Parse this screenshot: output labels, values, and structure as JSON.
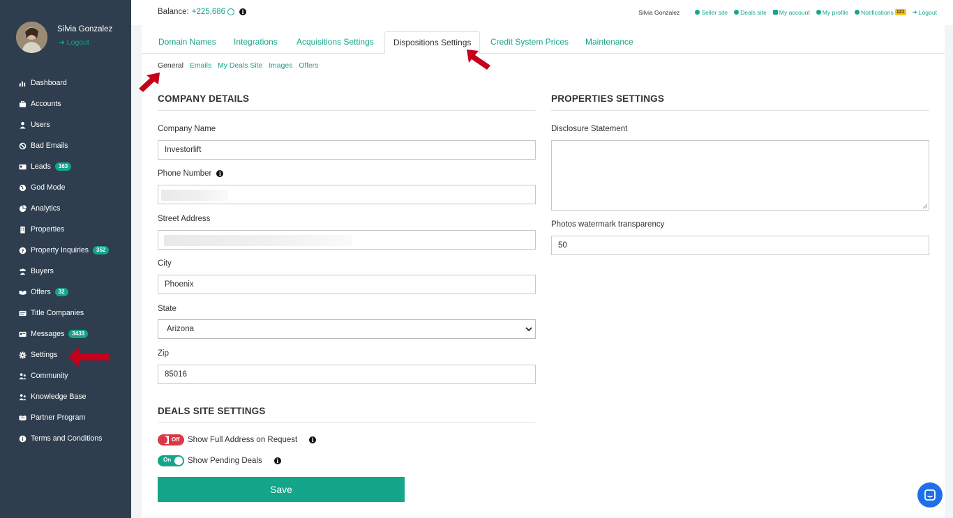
{
  "sidebar": {
    "user_name": "Silvia Gonzalez",
    "logout_label": "Logout",
    "items": [
      {
        "label": "Dashboard",
        "icon": "chart-icon"
      },
      {
        "label": "Accounts",
        "icon": "briefcase-icon"
      },
      {
        "label": "Users",
        "icon": "user-icon"
      },
      {
        "label": "Bad Emails",
        "icon": "ban-icon"
      },
      {
        "label": "Leads",
        "icon": "id-card-icon",
        "badge": "163"
      },
      {
        "label": "God Mode",
        "icon": "globe-icon"
      },
      {
        "label": "Analytics",
        "icon": "analytics-icon"
      },
      {
        "label": "Properties",
        "icon": "building-icon"
      },
      {
        "label": "Property Inquiries",
        "icon": "question-icon",
        "badge": "352"
      },
      {
        "label": "Buyers",
        "icon": "users-icon"
      },
      {
        "label": "Offers",
        "icon": "handshake-icon",
        "badge": "32"
      },
      {
        "label": "Title Companies",
        "icon": "list-icon"
      },
      {
        "label": "Messages",
        "icon": "message-icon",
        "badge": "3433"
      },
      {
        "label": "Settings",
        "icon": "gear-icon"
      },
      {
        "label": "Community",
        "icon": "community-icon"
      },
      {
        "label": "Knowledge Base",
        "icon": "knowledge-icon"
      },
      {
        "label": "Partner Program",
        "icon": "partner-icon"
      },
      {
        "label": "Terms and Conditions",
        "icon": "info-icon"
      }
    ]
  },
  "topbar": {
    "balance_label": "Balance:",
    "balance_value": "+225,686",
    "user_name": "Silvia Gonzalez",
    "links": {
      "seller_site": "Seller site",
      "deals_site": "Deals site",
      "my_account": "My account",
      "my_profile": "My profile",
      "notifications": "Notifications",
      "notifications_count": "121",
      "logout": "Logout"
    }
  },
  "tabs": [
    "Domain Names",
    "Integrations",
    "Acquisitions Settings",
    "Dispositions Settings",
    "Credit System Prices",
    "Maintenance"
  ],
  "active_tab": "Dispositions Settings",
  "subtabs": [
    "General",
    "Emails",
    "My Deals Site",
    "Images",
    "Offers"
  ],
  "active_subtab": "General",
  "company": {
    "title": "COMPANY DETAILS",
    "company_name_label": "Company Name",
    "company_name_value": "Investorlift",
    "phone_label": "Phone Number",
    "street_label": "Street Address",
    "city_label": "City",
    "city_value": "Phoenix",
    "state_label": "State",
    "state_value": "Arizona",
    "zip_label": "Zip",
    "zip_value": "85016"
  },
  "properties": {
    "title": "PROPERTIES SETTINGS",
    "disclosure_label": "Disclosure Statement",
    "watermark_label": "Photos watermark transparency",
    "watermark_value": "50"
  },
  "deals": {
    "title": "DEALS SITE SETTINGS",
    "full_address_label": "Show Full Address on Request",
    "full_address_state": "Off",
    "pending_label": "Show Pending Deals",
    "pending_state": "On",
    "save_label": "Save"
  },
  "colors": {
    "accent": "#14a58a",
    "sidebar_bg": "#2e3e4e",
    "annotation_arrow": "#c4001a",
    "toggle_off": "#dc3545"
  }
}
